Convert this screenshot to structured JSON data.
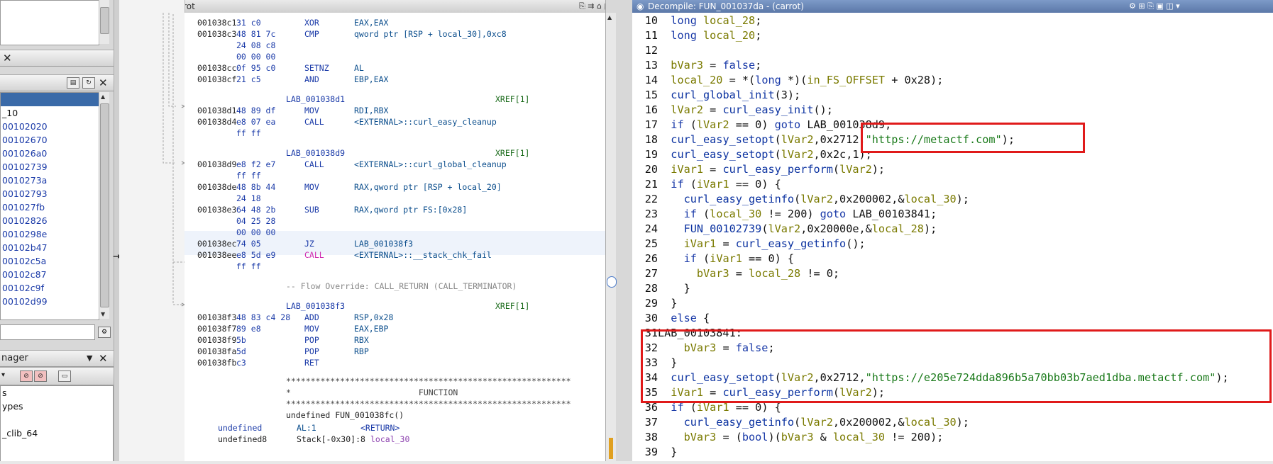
{
  "left_panel": {
    "tree_items": [
      "",
      "_10",
      "00102020",
      "00102670",
      "001026a0",
      "00102739",
      "0010273a",
      "00102793",
      "001027fb",
      "00102826",
      "0010298e",
      "00102b47",
      "00102c5a",
      "00102c87",
      "00102c9f",
      "00102d99"
    ],
    "manager_title": "nager",
    "manager_items": [
      "s",
      "ypes",
      "",
      "_clib_64"
    ]
  },
  "listing": {
    "title": "Listing:  carrot",
    "rows": [
      {
        "addr": "001038c1",
        "bytes": "31 c0",
        "mn": "XOR",
        "op": "EAX,EAX"
      },
      {
        "addr": "001038c3",
        "bytes": "48 81 7c",
        "mn": "CMP",
        "op": "qword ptr [RSP + local_30],0xc8"
      },
      {
        "addr": "",
        "bytes": "24 08 c8",
        "mn": "",
        "op": ""
      },
      {
        "addr": "",
        "bytes": "00 00 00",
        "mn": "",
        "op": ""
      },
      {
        "addr": "001038cc",
        "bytes": "0f 95 c0",
        "mn": "SETNZ",
        "op": "AL"
      },
      {
        "addr": "001038cf",
        "bytes": "21 c5",
        "mn": "AND",
        "op": "EBP,EAX"
      },
      {
        "label": "LAB_001038d1",
        "xref": "XREF[1]"
      },
      {
        "addr": "001038d1",
        "bytes": "48 89 df",
        "mn": "MOV",
        "op": "RDI,RBX"
      },
      {
        "addr": "001038d4",
        "bytes": "e8 07 ea",
        "mn": "CALL",
        "op": "<EXTERNAL>::curl_easy_cleanup"
      },
      {
        "addr": "",
        "bytes": "ff ff",
        "mn": "",
        "op": ""
      },
      {
        "label": "LAB_001038d9",
        "xref": "XREF[1]"
      },
      {
        "addr": "001038d9",
        "bytes": "e8 f2 e7",
        "mn": "CALL",
        "op": "<EXTERNAL>::curl_global_cleanup"
      },
      {
        "addr": "",
        "bytes": "ff ff",
        "mn": "",
        "op": ""
      },
      {
        "addr": "001038de",
        "bytes": "48 8b 44",
        "mn": "MOV",
        "op": "RAX,qword ptr [RSP + local_20]"
      },
      {
        "addr": "",
        "bytes": "24 18",
        "mn": "",
        "op": ""
      },
      {
        "addr": "001038e3",
        "bytes": "64 48 2b",
        "mn": "SUB",
        "op": "RAX,qword ptr FS:[0x28]"
      },
      {
        "addr": "",
        "bytes": "04 25 28",
        "mn": "",
        "op": ""
      },
      {
        "addr": "",
        "bytes": "00 00 00",
        "mn": "",
        "op": ""
      },
      {
        "addr": "001038ec",
        "bytes": "74 05",
        "mn": "JZ",
        "op": "LAB_001038f3"
      },
      {
        "addr": "001038ee",
        "bytes": "e8 5d e9",
        "mn": "CALL",
        "op": "<EXTERNAL>::__stack_chk_fail"
      },
      {
        "addr": "",
        "bytes": "ff ff",
        "mn": "",
        "op": ""
      },
      {
        "comment": "-- Flow Override: CALL_RETURN (CALL_TERMINATOR)"
      },
      {
        "label": "LAB_001038f3",
        "xref": "XREF[1]"
      },
      {
        "addr": "001038f3",
        "bytes": "48 83 c4 28",
        "mn": "ADD",
        "op": "RSP,0x28"
      },
      {
        "addr": "001038f7",
        "bytes": "89 e8",
        "mn": "MOV",
        "op": "EAX,EBP"
      },
      {
        "addr": "001038f9",
        "bytes": "5b",
        "mn": "POP",
        "op": "RBX"
      },
      {
        "addr": "001038fa",
        "bytes": "5d",
        "mn": "POP",
        "op": "RBP"
      },
      {
        "addr": "001038fb",
        "bytes": "c3",
        "mn": "RET",
        "op": ""
      }
    ],
    "stars": "**********************************************************",
    "function_banner": "*                          FUNCTION",
    "func_sig": "undefined FUN_001038fc()",
    "func_ret_type": "undefined",
    "func_ret_reg": "AL:1",
    "func_ret_name": "<RETURN>",
    "func_local_type": "undefined8",
    "func_local_loc": "Stack[-0x30]:8",
    "func_local_name": "local_30"
  },
  "decompile": {
    "title": "Decompile: FUN_001037da - (carrot)",
    "lines": [
      {
        "n": "10",
        "code": "  long local_28;"
      },
      {
        "n": "11",
        "code": "  long local_20;"
      },
      {
        "n": "12",
        "code": ""
      },
      {
        "n": "13",
        "code": "  bVar3 = false;"
      },
      {
        "n": "14",
        "code": "  local_20 = *(long *)(in_FS_OFFSET + 0x28);"
      },
      {
        "n": "15",
        "code": "  curl_global_init(3);"
      },
      {
        "n": "16",
        "code": "  lVar2 = curl_easy_init();"
      },
      {
        "n": "17",
        "code": "  if (lVar2 == 0) goto LAB_001038d9;"
      },
      {
        "n": "18",
        "code": "  curl_easy_setopt(lVar2,0x2712,\"https://metactf.com\");"
      },
      {
        "n": "19",
        "code": "  curl_easy_setopt(lVar2,0x2c,1);"
      },
      {
        "n": "20",
        "code": "  iVar1 = curl_easy_perform(lVar2);"
      },
      {
        "n": "21",
        "code": "  if (iVar1 == 0) {"
      },
      {
        "n": "22",
        "code": "    curl_easy_getinfo(lVar2,0x200002,&local_30);"
      },
      {
        "n": "23",
        "code": "    if (local_30 != 200) goto LAB_00103841;"
      },
      {
        "n": "24",
        "code": "    FUN_00102739(lVar2,0x20000e,&local_28);"
      },
      {
        "n": "25",
        "code": "    iVar1 = curl_easy_getinfo();"
      },
      {
        "n": "26",
        "code": "    if (iVar1 == 0) {"
      },
      {
        "n": "27",
        "code": "      bVar3 = local_28 != 0;"
      },
      {
        "n": "28",
        "code": "    }"
      },
      {
        "n": "29",
        "code": "  }"
      },
      {
        "n": "30",
        "code": "  else {"
      },
      {
        "n": "31",
        "code": "LAB_00103841:"
      },
      {
        "n": "32",
        "code": "    bVar3 = false;"
      },
      {
        "n": "33",
        "code": "  }"
      },
      {
        "n": "34",
        "code": "  curl_easy_setopt(lVar2,0x2712,\"https://e205e724dda896b5a70bb03b7aed1dba.metactf.com\");"
      },
      {
        "n": "35",
        "code": "  iVar1 = curl_easy_perform(lVar2);"
      },
      {
        "n": "36",
        "code": "  if (iVar1 == 0) {"
      },
      {
        "n": "37",
        "code": "    curl_easy_getinfo(lVar2,0x200002,&local_30);"
      },
      {
        "n": "38",
        "code": "    bVar3 = (bool)(bVar3 & local_30 != 200);"
      },
      {
        "n": "39",
        "code": "  }"
      }
    ]
  },
  "colors": {
    "highlight": "#e01a1a",
    "title_bar": "#6a88b8"
  }
}
